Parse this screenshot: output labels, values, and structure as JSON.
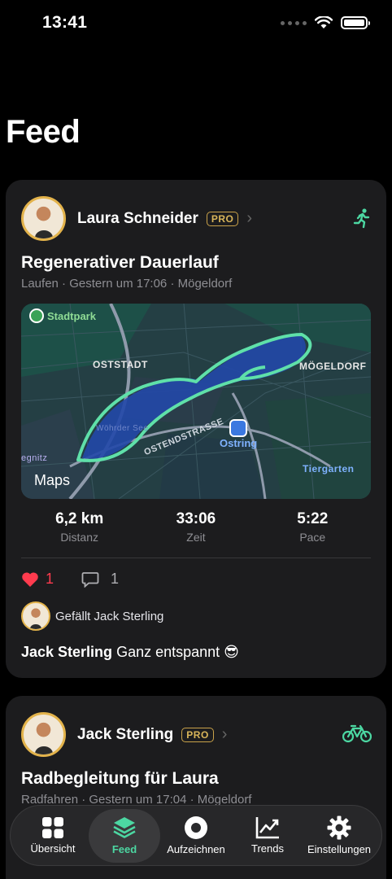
{
  "status": {
    "time": "13:41"
  },
  "page": {
    "title": "Feed"
  },
  "posts": [
    {
      "user": "Laura Schneider",
      "badge": "PRO",
      "title": "Regenerativer Dauerlauf",
      "meta": "Laufen · Gestern um 17:06 · Mögeldorf",
      "map": {
        "park": "Stadtpark",
        "labels": [
          "OSTSTADT",
          "MÖGELDORF",
          "OSTENDSTRASSE",
          "Wöhrder See",
          "Tiergarten",
          "egnitz",
          "Ostring"
        ],
        "maps_logo": "Maps"
      },
      "stats": [
        {
          "value": "6,2 km",
          "label": "Distanz"
        },
        {
          "value": "33:06",
          "label": "Zeit"
        },
        {
          "value": "5:22",
          "label": "Pace"
        }
      ],
      "likes": "1",
      "comments": "1",
      "liked_by": "Gefällt Jack Sterling",
      "comment_author": "Jack Sterling",
      "comment_text": "Ganz entspannt 😎"
    },
    {
      "user": "Jack Sterling",
      "badge": "PRO",
      "title": "Radbegleitung für Laura",
      "meta": "Radfahren · Gestern um 17:04 · Mögeldorf"
    }
  ],
  "tabs": [
    {
      "label": "Übersicht",
      "icon": "grid-icon"
    },
    {
      "label": "Feed",
      "icon": "layers-icon",
      "active": true
    },
    {
      "label": "Aufzeichnen",
      "icon": "record-icon"
    },
    {
      "label": "Trends",
      "icon": "chart-icon"
    },
    {
      "label": "Einstellungen",
      "icon": "gear-icon"
    }
  ],
  "colors": {
    "accent": "#4cd7a2",
    "pro": "#d9b55a",
    "like": "#ff3b4e"
  }
}
